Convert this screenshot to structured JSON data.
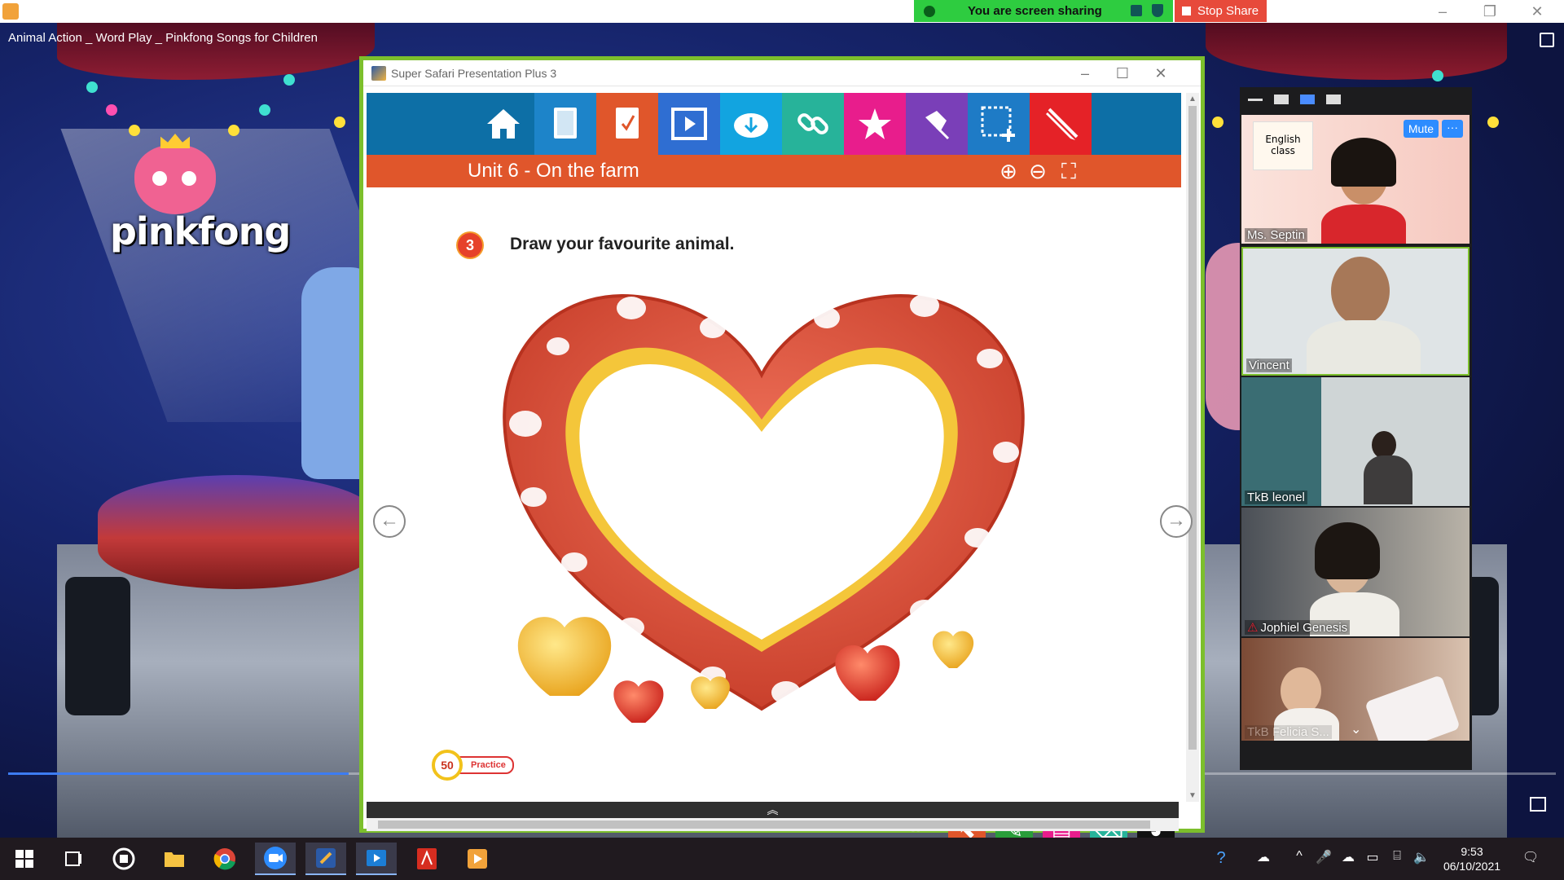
{
  "screen_share": {
    "status_text": "You are screen sharing",
    "stop_label": "Stop Share"
  },
  "video": {
    "title": "Animal Action _ Word Play _ Pinkfong Songs for Children",
    "logo_text": "pinkfong",
    "progress": 0.22
  },
  "app": {
    "window_title": "Super Safari Presentation Plus 3",
    "unit_title": "Unit 6 - On the farm",
    "toolbar_buttons": [
      {
        "icon": "home-icon",
        "color": "#0d6fa6"
      },
      {
        "icon": "book-icon",
        "color": "#1d84c9"
      },
      {
        "icon": "workbook-icon",
        "color": "#e0562b"
      },
      {
        "icon": "play-icon",
        "color": "#2f6ed2"
      },
      {
        "icon": "download-icon",
        "color": "#12a4e0"
      },
      {
        "icon": "link-icon",
        "color": "#27b39a"
      },
      {
        "icon": "star-icon",
        "color": "#e81d8c"
      },
      {
        "icon": "pin-icon",
        "color": "#7a3fb8"
      },
      {
        "icon": "selection-icon",
        "color": "#1e7bc6"
      },
      {
        "icon": "pencil-icon",
        "color": "#e52227"
      }
    ],
    "activity_number": "3",
    "instruction": "Draw your favourite animal.",
    "page_number": "50",
    "page_label": "Practice",
    "draw_tools": [
      {
        "icon": "pointer-icon",
        "color": "#e0562b"
      },
      {
        "icon": "pen-icon",
        "color": "#2a9d3a"
      },
      {
        "icon": "highlighter-icon",
        "color": "#e81d8c"
      },
      {
        "icon": "eraser-icon",
        "color": "#27b39a"
      },
      {
        "icon": "palette-icon",
        "color": "#111111"
      }
    ]
  },
  "participants": {
    "mute_label": "Mute",
    "more_label": "···",
    "card_text": "English class",
    "people": [
      {
        "name": "Ms. Septin"
      },
      {
        "name": "Vincent"
      },
      {
        "name": "TkB leonel"
      },
      {
        "name": "Jophiel Genesis"
      },
      {
        "name": "TkB Felicia S..."
      }
    ]
  },
  "taskbar": {
    "time": "9:53",
    "date": "06/10/2021"
  }
}
